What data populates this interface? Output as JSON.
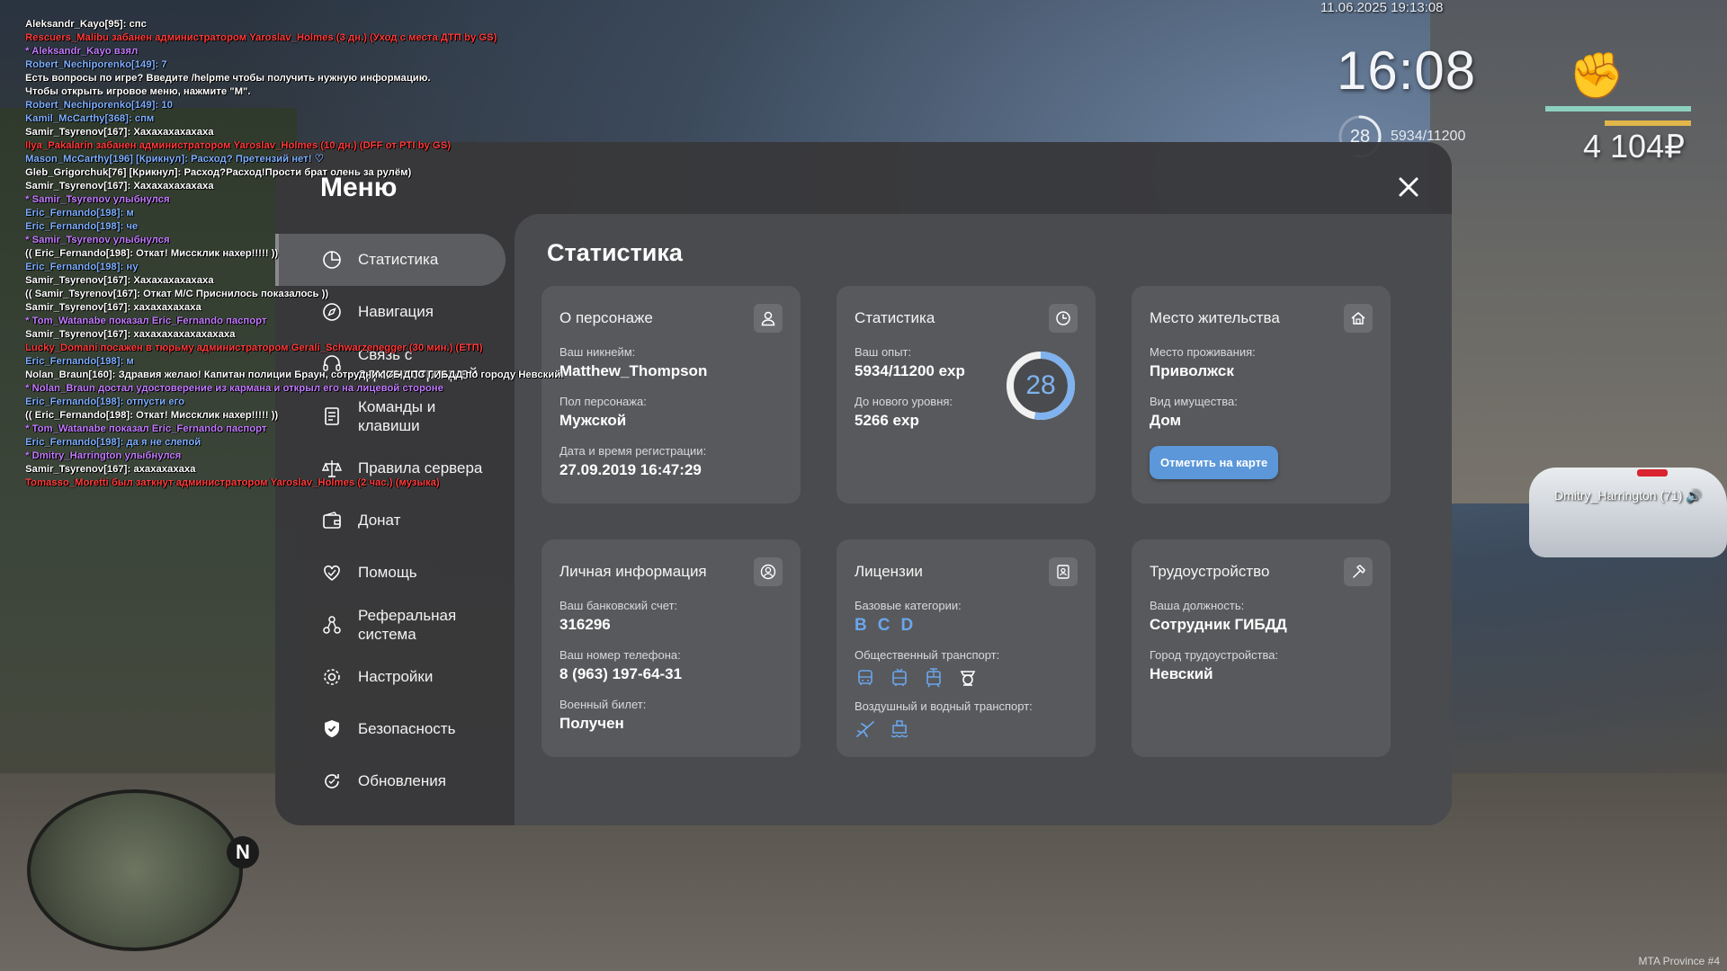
{
  "chat": [
    {
      "text": "Aleksandr_Kayo[95]: спс",
      "color": "#ffffff"
    },
    {
      "text": "Rescuers_Malibu забанен администратором Yaroslav_Holmes (3 дн.) (Уход с места ДТП by GS)",
      "color": "#ff3b3b"
    },
    {
      "text": "* Aleksandr_Kayo взял",
      "color": "#c47cff"
    },
    {
      "text": "Robert_Nechiporenko[149]: 7",
      "color": "#7fb0ff"
    },
    {
      "text": "Есть вопросы по игре? Введите /helpme чтобы получить нужную информацию.",
      "color": "#ffffff"
    },
    {
      "text": "Чтобы открыть игровое меню, нажмите \"M\".",
      "color": "#ffffff"
    },
    {
      "text": "Robert_Nechiporenko[149]: 10",
      "color": "#7fb0ff"
    },
    {
      "text": "Kamil_McCarthy[368]: спм",
      "color": "#7fb0ff"
    },
    {
      "text": "Samir_Tsyrenov[167]: Хахахахахахаха",
      "color": "#ffffff"
    },
    {
      "text": "Ilya_Pakalarin забанен администратором Yaroslav_Holmes (10 дн.) (DFF от PTI by GS)",
      "color": "#ff3b3b"
    },
    {
      "text": "Mason_McCarthy[196] [Крикнул]: Расход? Претензий нет! ♡",
      "color": "#7fb0ff"
    },
    {
      "text": "Gleb_Grigorchuk[76] [Крикнул]: Расход?Расход!Прости брат олень за рулём)",
      "color": "#ffffff"
    },
    {
      "text": "Samir_Tsyrenov[167]: Хахахахахахаха",
      "color": "#ffffff"
    },
    {
      "text": "* Samir_Tsyrenov улыбнулся",
      "color": "#c47cff"
    },
    {
      "text": "Eric_Fernando[198]: м",
      "color": "#7fb0ff"
    },
    {
      "text": "Eric_Fernando[198]: че",
      "color": "#7fb0ff"
    },
    {
      "text": "* Samir_Tsyrenov улыбнулся",
      "color": "#c47cff"
    },
    {
      "text": "(( Eric_Fernando[198]: Откат! Миссклик нахер!!!!! ))",
      "color": "#ffffff"
    },
    {
      "text": "Eric_Fernando[198]: ну",
      "color": "#7fb0ff"
    },
    {
      "text": "Samir_Tsyrenov[167]: Хахахахахахаха",
      "color": "#ffffff"
    },
    {
      "text": "(( Samir_Tsyrenov[167]: Откат М/С Приснилось показалось ))",
      "color": "#ffffff"
    },
    {
      "text": "Samir_Tsyrenov[167]: хахахахахаха",
      "color": "#ffffff"
    },
    {
      "text": "* Tom_Watanabe показал Eric_Fernando паспорт",
      "color": "#c47cff"
    },
    {
      "text": "Samir_Tsyrenov[167]: хахахахахахахахаха",
      "color": "#ffffff"
    },
    {
      "text": "Lucky_Domani посажен в тюрьму администратором Gerali_Schwarzenegger (30 мин.) (ЕТП)",
      "color": "#ff3b3b"
    },
    {
      "text": "Eric_Fernando[198]: м",
      "color": "#7fb0ff"
    },
    {
      "text": "Nolan_Braun[160]: Здравия желаю! Капитан полиции Браун, сотрудник СБ ДПС ГИБДД по городу Невский.",
      "color": "#ffffff"
    },
    {
      "text": "* Nolan_Braun достал удостоверение из кармана и открыл его на лицевой стороне",
      "color": "#c47cff"
    },
    {
      "text": "Eric_Fernando[198]: отпусти его",
      "color": "#7fb0ff"
    },
    {
      "text": "(( Eric_Fernando[198]: Откат! Миссклик нахер!!!!! ))",
      "color": "#ffffff"
    },
    {
      "text": "* Tom_Watanabe показал Eric_Fernando паспорт",
      "color": "#c47cff"
    },
    {
      "text": "Eric_Fernando[198]: да я не слепой",
      "color": "#7fb0ff"
    },
    {
      "text": "* Dmitry_Harrington улыбнулся",
      "color": "#c47cff"
    },
    {
      "text": "Samir_Tsyrenov[167]: ахахахахаха",
      "color": "#ffffff"
    },
    {
      "text": "Tomasso_Moretti был заткнут администратором Yaroslav_Holmes (2 час.) (музыка)",
      "color": "#ff3b3b"
    }
  ],
  "hud": {
    "datetime": "11.06.2025 19:13:08",
    "time": "16:08",
    "level": "28",
    "exp": "5934/11200",
    "exp_fraction": 0.53,
    "money": "4 104₽",
    "health_fraction": 1.0,
    "armor_fraction": 0.6
  },
  "player_tag": "Dmitry_Harrington (71) 🔊",
  "watermark": "MTA Province #4",
  "minimap": {
    "north": "N"
  },
  "menu": {
    "title": "Меню",
    "close_label": "×",
    "nav": [
      {
        "label": "Статистика",
        "icon": "pie-chart-icon",
        "active": true
      },
      {
        "label": "Навигация",
        "icon": "compass-icon",
        "active": false
      },
      {
        "label": "Связь с\nадминистрацией",
        "icon": "headset-icon",
        "active": false
      },
      {
        "label": "Команды и\nклавиши",
        "icon": "document-icon",
        "active": false
      },
      {
        "label": "Правила сервера",
        "icon": "scales-icon",
        "active": false
      },
      {
        "label": "Донат",
        "icon": "wallet-icon",
        "active": false
      },
      {
        "label": "Помощь",
        "icon": "heart-hands-icon",
        "active": false
      },
      {
        "label": "Реферальная\nсистема",
        "icon": "referral-icon",
        "active": false
      },
      {
        "label": "Настройки",
        "icon": "gear-icon",
        "active": false
      },
      {
        "label": "Безопасность",
        "icon": "shield-icon",
        "active": false
      },
      {
        "label": "Обновления",
        "icon": "refresh-icon",
        "active": false
      }
    ],
    "content_title": "Статистика",
    "character": {
      "title": "О персонаже",
      "nickname_label": "Ваш никнейм:",
      "nickname": "Matthew_Thompson",
      "gender_label": "Пол персонажа:",
      "gender": "Мужской",
      "reg_label": "Дата и время регистрации:",
      "reg_date": "27.09.2019 16:47:29"
    },
    "stats": {
      "title": "Статистика",
      "exp_label": "Ваш опыт:",
      "exp": "5934/11200 exp",
      "next_label": "До нового уровня:",
      "next": "5266 exp",
      "level": "28",
      "progress": 0.53,
      "ring_color": "#7fb2ee"
    },
    "residence": {
      "title": "Место жительства",
      "place_label": "Место проживания:",
      "place": "Приволжск",
      "property_label": "Вид имущества:",
      "property": "Дом",
      "map_button": "Отметить на карте"
    },
    "personal": {
      "title": "Личная информация",
      "bank_label": "Ваш банковский счет:",
      "bank": "316296",
      "phone_label": "Ваш номер телефона:",
      "phone": "8 (963) 197-64-31",
      "military_label": "Военный билет:",
      "military": "Получен"
    },
    "licenses": {
      "title": "Лицензии",
      "base_label": "Базовые категории:",
      "base": [
        "B",
        "C",
        "D"
      ],
      "public_label": "Общественный транспорт:",
      "public_icons": [
        "bus-icon",
        "trolleybus-icon",
        "tram-icon",
        "train-icon"
      ],
      "air_label": "Воздушный и водный транспорт:",
      "air_icons": [
        "plane-icon",
        "boat-icon"
      ]
    },
    "job": {
      "title": "Трудоустройство",
      "position_label": "Ваша должность:",
      "position": "Сотрудник ГИБДД",
      "city_label": "Город трудоустройства:",
      "city": "Невский"
    }
  },
  "colors": {
    "accent_blue": "#5b97d9",
    "license_blue": "#6aa6ec",
    "panel": "#4a4b4e",
    "card": "#58595c"
  }
}
